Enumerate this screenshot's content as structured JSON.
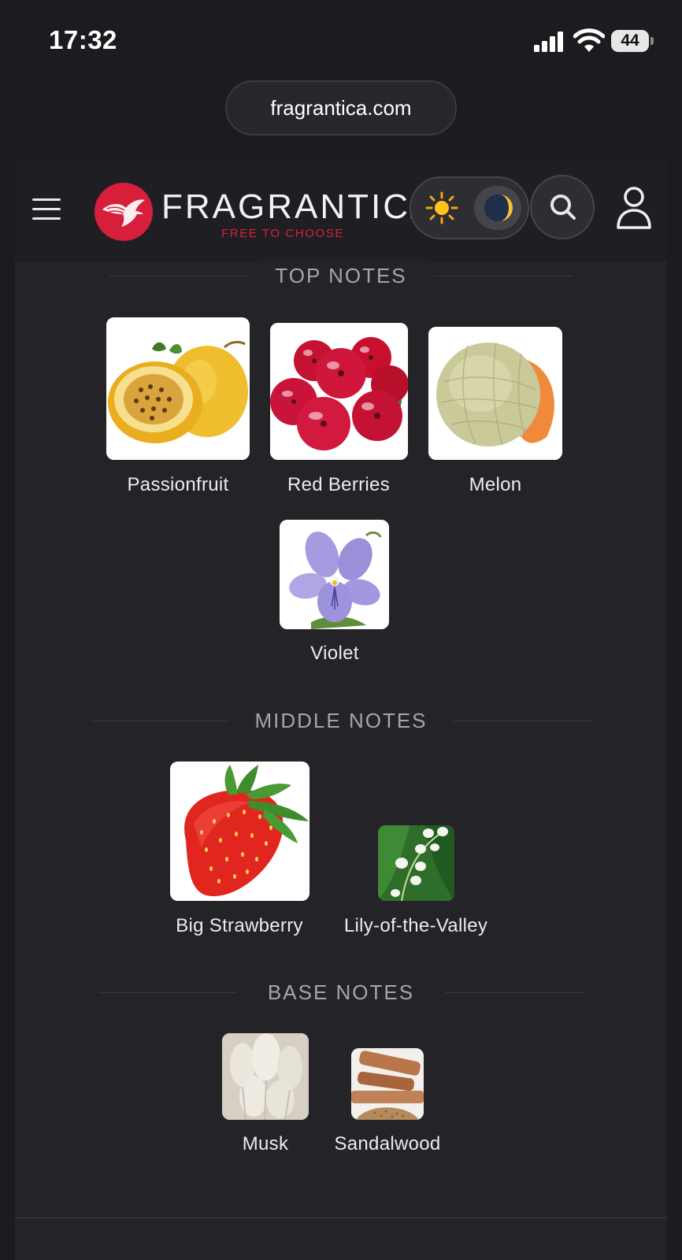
{
  "status_bar": {
    "time": "17:32",
    "battery": "44"
  },
  "browser": {
    "url": "fragrantica.com"
  },
  "header": {
    "logo_text": "FRAGRANTICA",
    "tagline": "FREE TO CHOOSE",
    "icons": [
      "hamburger-menu-icon",
      "hummingbird-logo",
      "sun-icon",
      "moon-icon",
      "search-icon",
      "user-icon"
    ],
    "brand_color": "#d71f3c"
  },
  "sections": {
    "top": {
      "heading": "TOP NOTES",
      "notes": [
        {
          "name": "Passionfruit"
        },
        {
          "name": "Red Berries"
        },
        {
          "name": "Melon"
        },
        {
          "name": "Violet"
        }
      ]
    },
    "middle": {
      "heading": "MIDDLE NOTES",
      "notes": [
        {
          "name": "Big Strawberry"
        },
        {
          "name": "Lily-of-the-Valley"
        }
      ]
    },
    "base": {
      "heading": "BASE NOTES",
      "notes": [
        {
          "name": "Musk"
        },
        {
          "name": "Sandalwood"
        }
      ]
    }
  }
}
